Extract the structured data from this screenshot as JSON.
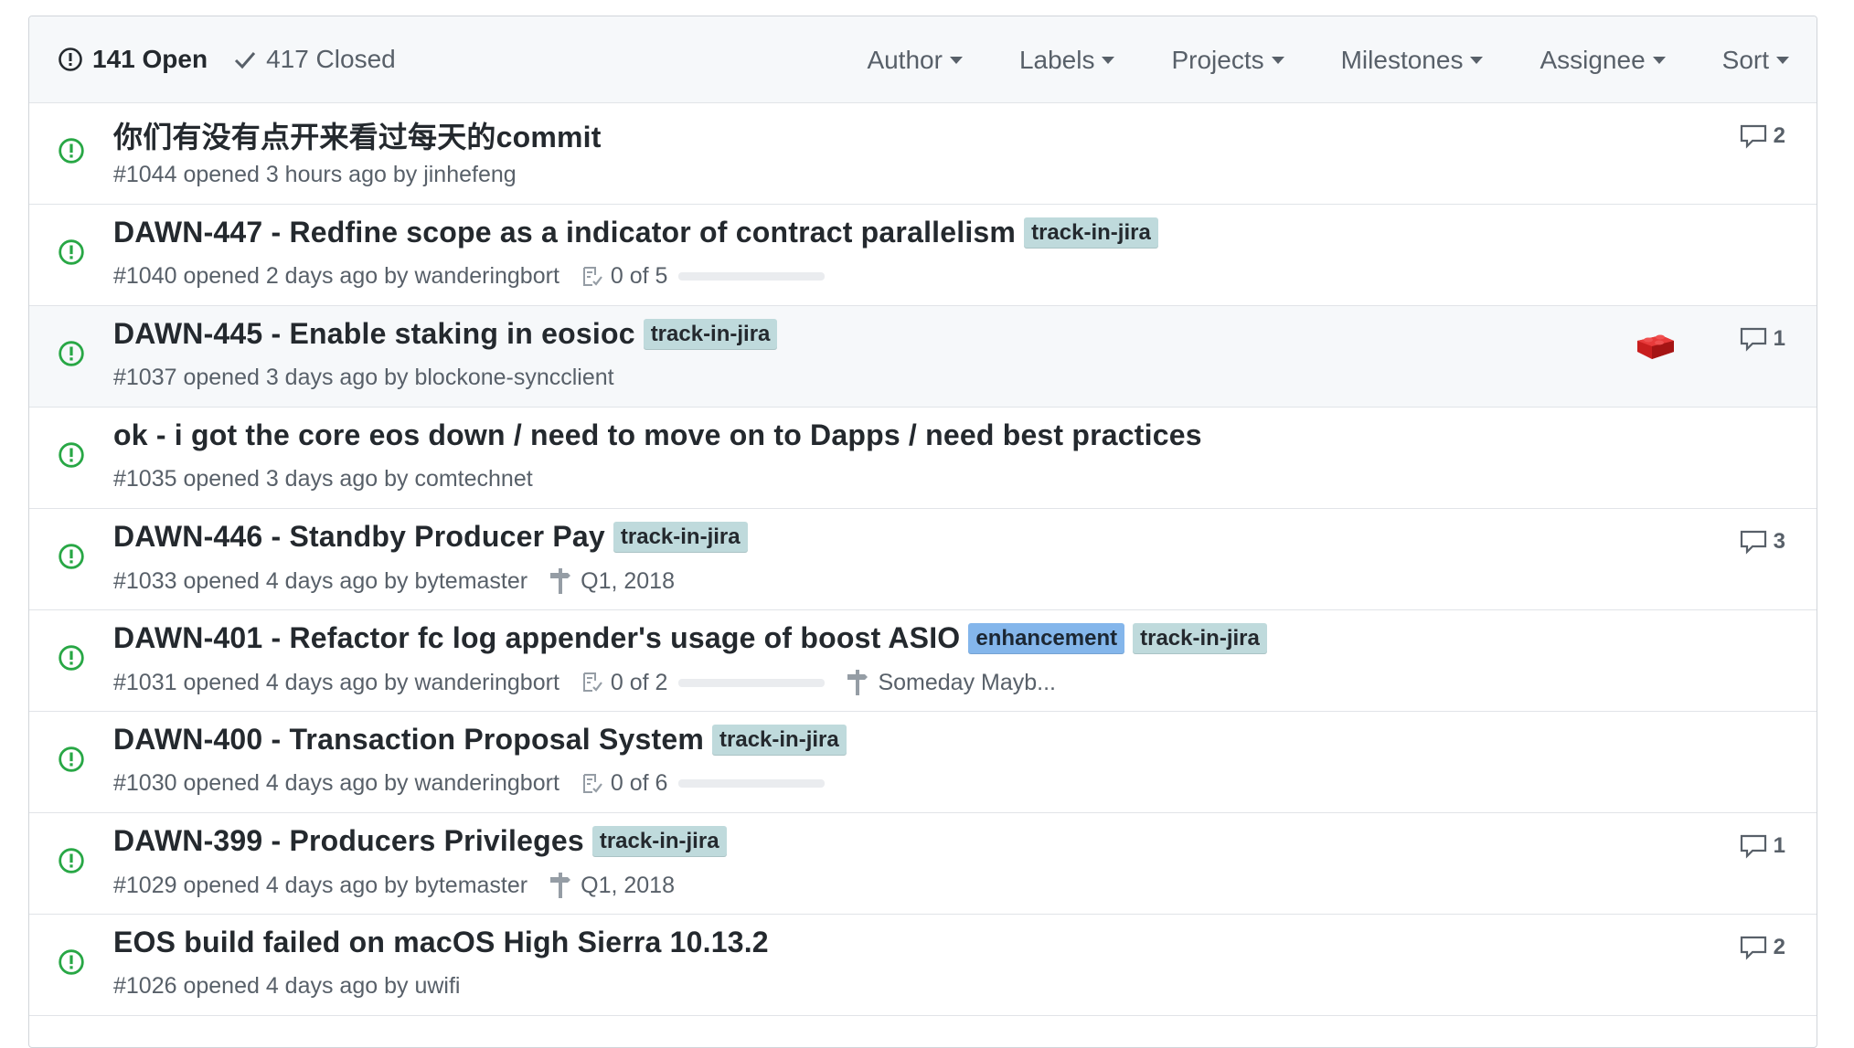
{
  "header": {
    "open_label": "141 Open",
    "closed_label": "417 Closed",
    "filters": [
      "Author",
      "Labels",
      "Projects",
      "Milestones",
      "Assignee",
      "Sort"
    ]
  },
  "colors": {
    "open_green": "#28a745",
    "track_in_jira": "#bfdadc",
    "enhancement": "#84b6eb"
  },
  "issues": [
    {
      "title": "你们有没有点开来看过每天的commit",
      "meta": "#1044 opened 3 hours ago by ",
      "author": "jinhefeng",
      "comments": "2"
    },
    {
      "title": "DAWN-447 - Redfine scope as a indicator of contract parallelism",
      "label1": "track-in-jira",
      "meta": "#1040 opened 2 days ago by ",
      "author": "wanderingbort",
      "tasks": "0 of 5"
    },
    {
      "title": "DAWN-445 - Enable staking in eosioc",
      "label1": "track-in-jira",
      "meta": "#1037 opened 3 days ago by ",
      "author": "blockone-syncclient",
      "comments": "1"
    },
    {
      "title": "ok - i got the core eos down / need to move on to Dapps / need best practices",
      "meta": "#1035 opened 3 days ago by ",
      "author": "comtechnet"
    },
    {
      "title": "DAWN-446 - Standby Producer Pay",
      "label1": "track-in-jira",
      "meta": "#1033 opened 4 days ago by ",
      "author": "bytemaster",
      "milestone": "Q1, 2018",
      "comments": "3"
    },
    {
      "title": "DAWN-401 - Refactor fc log appender's usage of boost ASIO",
      "label1": "enhancement",
      "label2": "track-in-jira",
      "meta": "#1031 opened 4 days ago by ",
      "author": "wanderingbort",
      "tasks": "0 of 2",
      "milestone": "Someday Mayb..."
    },
    {
      "title": "DAWN-400 - Transaction Proposal System",
      "label1": "track-in-jira",
      "meta": "#1030 opened 4 days ago by ",
      "author": "wanderingbort",
      "tasks": "0 of 6"
    },
    {
      "title": "DAWN-399 - Producers Privileges",
      "label1": "track-in-jira",
      "meta": "#1029 opened 4 days ago by ",
      "author": "bytemaster",
      "milestone": "Q1, 2018",
      "comments": "1"
    },
    {
      "title": "EOS build failed on macOS High Sierra 10.13.2",
      "meta": "#1026 opened 4 days ago by ",
      "author": "uwifi",
      "comments": "2"
    }
  ]
}
